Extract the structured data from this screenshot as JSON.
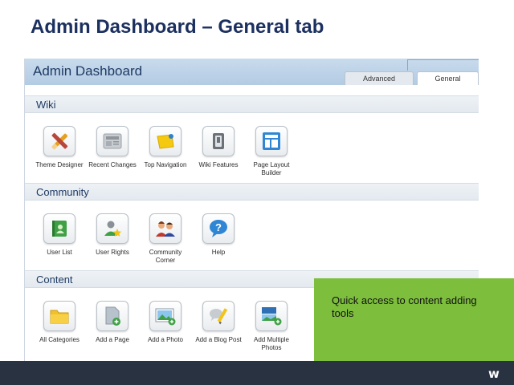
{
  "slide": {
    "title": "Admin Dashboard – General tab"
  },
  "dashboard": {
    "title": "Admin Dashboard",
    "tabs": [
      {
        "label": "Advanced",
        "active": false
      },
      {
        "label": "General",
        "active": true
      }
    ],
    "sections": [
      {
        "label": "Wiki",
        "tools": [
          {
            "label": "Theme Designer",
            "icon": "theme-designer-icon"
          },
          {
            "label": "Recent Changes",
            "icon": "recent-changes-icon"
          },
          {
            "label": "Top Navigation",
            "icon": "top-navigation-icon"
          },
          {
            "label": "Wiki Features",
            "icon": "wiki-features-icon"
          },
          {
            "label": "Page Layout Builder",
            "icon": "page-layout-builder-icon"
          }
        ]
      },
      {
        "label": "Community",
        "tools": [
          {
            "label": "User List",
            "icon": "user-list-icon"
          },
          {
            "label": "User Rights",
            "icon": "user-rights-icon"
          },
          {
            "label": "Community Corner",
            "icon": "community-corner-icon"
          },
          {
            "label": "Help",
            "icon": "help-icon"
          }
        ]
      },
      {
        "label": "Content",
        "tools": [
          {
            "label": "All Categories",
            "icon": "folder-icon"
          },
          {
            "label": "Add a Page",
            "icon": "add-page-icon"
          },
          {
            "label": "Add a Photo",
            "icon": "add-photo-icon"
          },
          {
            "label": "Add a Blog Post",
            "icon": "add-blog-post-icon"
          },
          {
            "label": "Add Multiple Photos",
            "icon": "add-multiple-photos-icon"
          }
        ]
      }
    ]
  },
  "callout": {
    "text": "Quick access to content adding tools"
  },
  "footer": {
    "logo": "w",
    "logo_icon": "wikia-logo-icon"
  },
  "colors": {
    "title": "#1c3060",
    "header": "#c2d5ea",
    "callout": "#7dbe3d",
    "footer": "#283240"
  }
}
